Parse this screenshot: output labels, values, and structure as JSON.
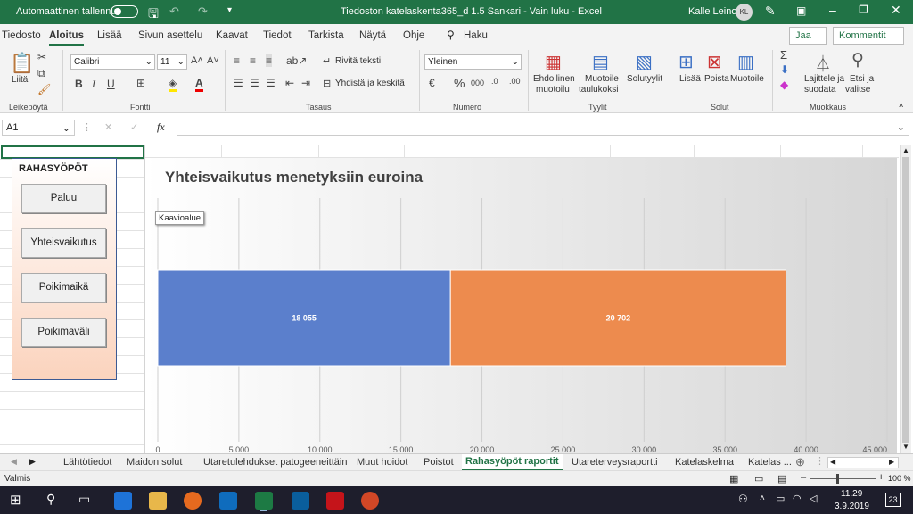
{
  "titlebar": {
    "autosave": "Automaattinen tallennus",
    "title": "Tiedoston katelaskenta365_d  1.5 Sankari  -  Vain luku  -  Excel",
    "user": "Kalle Leino",
    "initials": "KL"
  },
  "menu": [
    "Tiedosto",
    "Aloitus",
    "Lisää",
    "Sivun asettelu",
    "Kaavat",
    "Tiedot",
    "Tarkista",
    "Näytä",
    "Ohje"
  ],
  "search": "Haku",
  "share": "Jaa",
  "comment": "Kommentit",
  "ribbon": {
    "paste": "Liitä",
    "clipboard": "Leikepöytä",
    "font_group": "Fontti",
    "font": "Calibri",
    "size": "11",
    "wrap": "Rivitä teksti",
    "merge": "Yhdistä ja keskitä",
    "align_group": "Tasaus",
    "numfmt": "Yleinen",
    "num_group": "Numero",
    "cond1": "Ehdollinen",
    "cond2": "muotoilu",
    "table1": "Muotoile",
    "table2": "taulukoksi",
    "styles": "Solutyylit",
    "styles_group": "Tyylit",
    "insert": "Lisää",
    "delete": "Poista",
    "format": "Muotoile",
    "cells_group": "Solut",
    "sort1": "Lajittele ja",
    "sort2": "suodata",
    "find1": "Etsi ja",
    "find2": "valitse",
    "edit_group": "Muokkaus"
  },
  "namebox": "A1",
  "panel": {
    "title": "RAHASYÖPÖT",
    "buttons": [
      "Paluu",
      "Yhteisvaikutus",
      "Poikimaikä",
      "Poikimaväli"
    ]
  },
  "chart_data": {
    "type": "bar",
    "orientation": "horizontal",
    "stacked": true,
    "title": "Yhteisvaikutus menetyksiin euroina",
    "tooltip": "Kaavioalue",
    "series": [
      {
        "values": [
          18055
        ],
        "labels": [
          "18 055"
        ],
        "color": "#5b7fcc"
      },
      {
        "values": [
          20702
        ],
        "labels": [
          "20 702"
        ],
        "color": "#ed8b4e"
      }
    ],
    "xlim": [
      0,
      45000
    ],
    "ticks": [
      0,
      5000,
      10000,
      15000,
      20000,
      25000,
      30000,
      35000,
      40000,
      45000
    ],
    "tick_labels": [
      "0",
      "5 000",
      "10 000",
      "15 000",
      "20 000",
      "25 000",
      "30 000",
      "35 000",
      "40 000",
      "45 000"
    ],
    "grid": true
  },
  "tabs": [
    "Lähtötiedot",
    "Maidon solut",
    "Utaretulehdukset patogeeneittäin",
    "Muut hoidot",
    "Poistot",
    "Rahasyöpöt raportit",
    "Utareterveysraportti",
    "Katelaskelma",
    "Katelas ..."
  ],
  "status": {
    "mode": "Valmis",
    "zoom": "100 %"
  },
  "taskbar": {
    "time": "11.29",
    "date": "3.9.2019",
    "badge": "23"
  }
}
